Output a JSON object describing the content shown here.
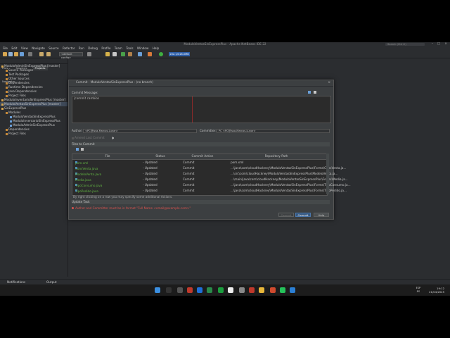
{
  "app": {
    "title": "ModuloVentasSinExpressPlus - Apache NetBeans IDE 22",
    "search_placeholder": "Search (Ctrl+I)",
    "menu": [
      "File",
      "Edit",
      "View",
      "Navigate",
      "Source",
      "Refactor",
      "Run",
      "Debug",
      "Profile",
      "Team",
      "Tools",
      "Window",
      "Help"
    ],
    "config": "<default config>",
    "memory": "202.1/418.0MB"
  },
  "left_panel": {
    "tabs": [
      "Files",
      "Services",
      "Projects",
      "Navigator"
    ],
    "tree": [
      "ModuloAdminSinExpressPlus [master]",
      "Source Packages",
      "Test Packages",
      "Other Sources",
      "Dependencies",
      "Runtime Dependencies",
      "Java Dependencies",
      "Project Files",
      "ModuloInventarioSinExpressPlus [master]",
      "ModuloVentasSinExpressPlus [master]",
      "SinExpressPlus",
      "Modules",
      "ModuloVentasSinExpressPlus",
      "ModuloInventarioSinExpressPlus",
      "ModuloAdminSinExpressPlus",
      "Dependencies",
      "Project Files"
    ]
  },
  "statusbar": {
    "notifications": "Notifications",
    "output": "Output"
  },
  "taskbar": {
    "lang_top": "ESP",
    "lang_bottom": "ES",
    "time": "19:12",
    "date": "21/04/2025"
  },
  "dialog": {
    "title": "Commit - ModuloVentasSinExpressPlus - (no branch)",
    "commit_message_label": "Commit Message:",
    "commit_message_value": "|commit cambios",
    "author_label": "Author:",
    "author_value": "<PC@Issa-Marcos-Lunar>",
    "committer_label": "Committer:",
    "committer_value": "PC <PC@Issa-Marcos-Lunar>",
    "amend_label": "Amend Last Commit",
    "files_section": "Files to Commit",
    "columns": [
      "File",
      "Status",
      "Commit Action",
      "Repository Path"
    ],
    "files": [
      {
        "file": "pom.xml",
        "status": "- Updated",
        "action": "Commit",
        "path": "pom.xml"
      },
      {
        "file": "ConsVenta.java",
        "status": "- Updated",
        "action": "Commit",
        "path": "...\\java\\com\\cloudHackney\\ModuloVentasSinExpressPlus\\Forms\\ConsVenta.ja..."
      },
      {
        "file": "ModeloVenta.java",
        "status": "- Updated",
        "action": "Commit",
        "path": "...\\src\\com\\cloudHackney\\ModuloVentasSinExpressPlus\\ModeloVenta.ja..."
      },
      {
        "file": "Media.java",
        "status": "- Updated",
        "action": "Commit",
        "path": "...\\main\\java\\com\\cloudHackney\\ModuloVentasSinExpressPlus\\Forms\\Media.ja..."
      },
      {
        "file": "TipoConsumo.java",
        "status": "- Updated",
        "action": "Commit",
        "path": "...\\java\\com\\cloudHackney\\ModuloVentasSinExpressPlus\\Forms\\TipoConsumo.ja..."
      },
      {
        "file": "TipoPedido.java",
        "status": "- Updated",
        "action": "Commit",
        "path": "...\\java\\com\\cloudHackney\\ModuloVentasSinExpressPlus\\Forms\\TipoPedido.ja..."
      }
    ],
    "hint": "By right clicking on a row you may specify some additional Actions.",
    "update_section": "Update Task",
    "error": "Author and Committer must be in format \"Full Name <email@example.com>\"",
    "buttons": {
      "commit_disabled": "Commit",
      "commit": "Commit",
      "help": "Help"
    }
  }
}
